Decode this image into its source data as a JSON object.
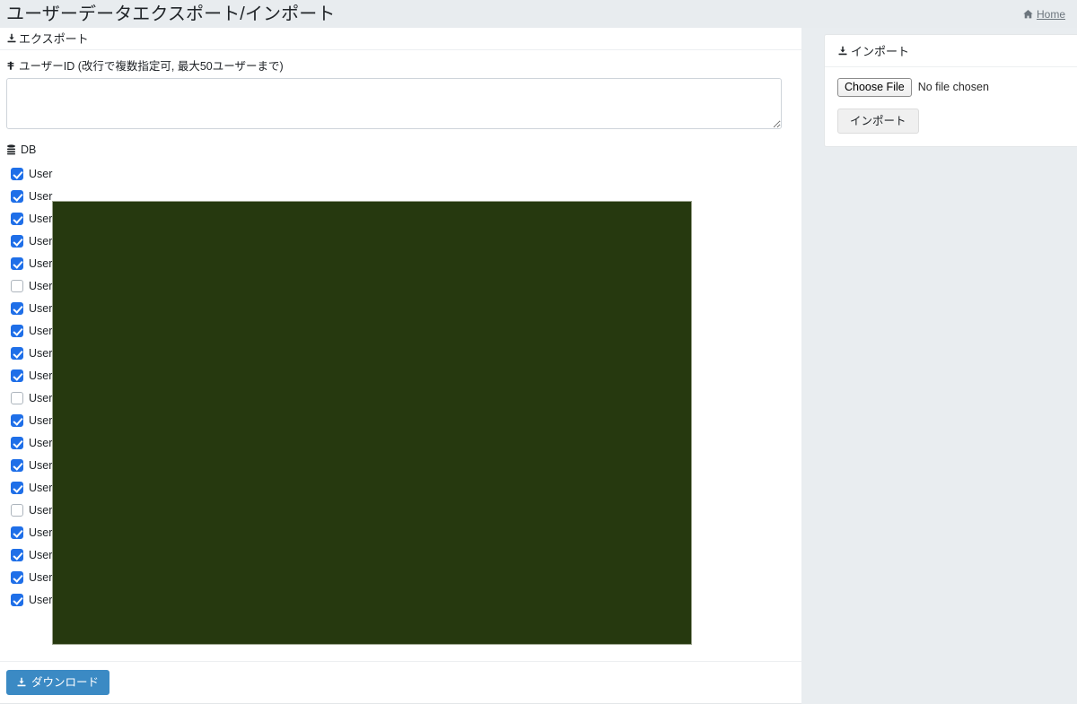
{
  "header": {
    "title": "ユーザーデータエクスポート/インポート",
    "home_label": "Home",
    "home_icon": "home-icon"
  },
  "export": {
    "section_title": "エクスポート",
    "section_icon": "export-upload-icon",
    "userid_label": "ユーザーID (改行で複数指定可, 最大50ユーザーまで)",
    "userid_icon": "user-icon",
    "userid_value": "",
    "userid_placeholder": "",
    "db_label": "DB",
    "db_icon": "database-icon",
    "download_button": "ダウンロード",
    "download_icon": "download-icon",
    "db_items": [
      {
        "label": "User",
        "checked": true
      },
      {
        "label": "User",
        "checked": true
      },
      {
        "label": "User",
        "checked": true
      },
      {
        "label": "User",
        "checked": true
      },
      {
        "label": "User",
        "checked": true
      },
      {
        "label": "User",
        "checked": false
      },
      {
        "label": "User",
        "checked": true
      },
      {
        "label": "User",
        "checked": true
      },
      {
        "label": "User",
        "checked": true
      },
      {
        "label": "User",
        "checked": true
      },
      {
        "label": "User",
        "checked": false
      },
      {
        "label": "User",
        "checked": true
      },
      {
        "label": "User",
        "checked": true
      },
      {
        "label": "User",
        "checked": true
      },
      {
        "label": "User",
        "checked": true
      },
      {
        "label": "User",
        "checked": false
      },
      {
        "label": "User",
        "checked": true
      },
      {
        "label": "User",
        "checked": true
      },
      {
        "label": "User",
        "checked": true
      },
      {
        "label": "User",
        "checked": true
      }
    ]
  },
  "import": {
    "section_title": "インポート",
    "section_icon": "import-download-icon",
    "choose_file_label": "Choose File",
    "no_file_label": "No file chosen",
    "import_button": "インポート"
  },
  "overlay": {
    "color": "#26390f",
    "border_color": "#9ca48e"
  },
  "colors": {
    "header_band": "#e8ecef",
    "page_background": "#e9edf0",
    "card_background": "#ffffff",
    "accent_blue": "#3b8ac4",
    "checkbox_blue": "#1f6fe8",
    "muted_text": "#6c757d"
  }
}
